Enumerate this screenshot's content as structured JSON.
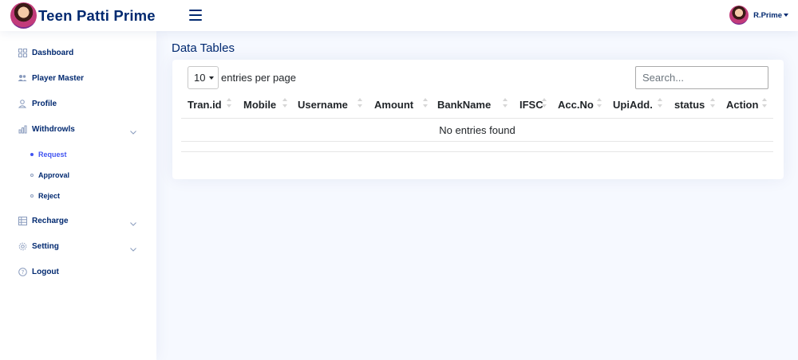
{
  "app": {
    "title": "Teen Patti Prime"
  },
  "user": {
    "name": "R.Prime"
  },
  "sidebar": {
    "items": [
      {
        "label": "Dashboard",
        "icon": "grid-icon"
      },
      {
        "label": "Player Master",
        "icon": "people-icon"
      },
      {
        "label": "Profile",
        "icon": "person-icon"
      },
      {
        "label": "Withdrowls",
        "icon": "bar-chart-icon",
        "expanded": true,
        "children": [
          {
            "label": "Request",
            "active": true
          },
          {
            "label": "Approval",
            "active": false
          },
          {
            "label": "Reject",
            "active": false
          }
        ]
      },
      {
        "label": "Recharge",
        "icon": "table-icon"
      },
      {
        "label": "Setting",
        "icon": "gear-icon"
      },
      {
        "label": "Logout",
        "icon": "question-circle-icon"
      }
    ]
  },
  "main": {
    "page_title": "Data Tables",
    "table": {
      "page_size": "10",
      "per_page_text": "entries per page",
      "search_placeholder": "Search...",
      "columns": [
        "Tran.id",
        "Mobile",
        "Username",
        "Amount",
        "BankName",
        "IFSC",
        "Acc.No",
        "UpiAdd.",
        "status",
        "Action"
      ],
      "empty_message": "No entries found"
    }
  },
  "colors": {
    "brand": "#012970",
    "accent": "#4154f1",
    "muted": "#899bbd",
    "background": "#f6f9ff"
  }
}
